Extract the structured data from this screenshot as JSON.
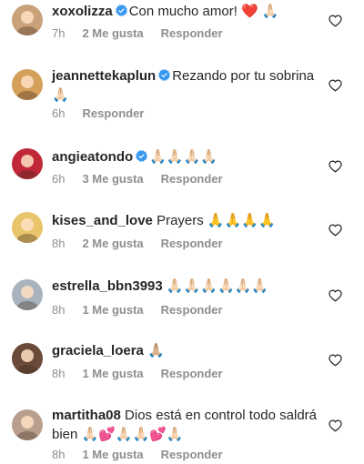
{
  "comments": [
    {
      "username": "xoxolizza",
      "verified": true,
      "text": "Con mucho amor! ❤️ 🙏🏻",
      "time": "7h",
      "likes": "2 Me gusta",
      "reply": "Responder",
      "avatar_color": "#c9a27a"
    },
    {
      "username": "jeannettekaplun",
      "verified": true,
      "text": "Rezando por tu sobrina 🙏🏻",
      "time": "6h",
      "likes": "",
      "reply": "Responder",
      "avatar_color": "#d4a05a"
    },
    {
      "username": "angieatondo",
      "verified": true,
      "text": "🙏🏻🙏🏻🙏🏻🙏🏻",
      "time": "6h",
      "likes": "3 Me gusta",
      "reply": "Responder",
      "avatar_color": "#c0283a"
    },
    {
      "username": "kises_and_love",
      "verified": false,
      "text": "Prayers 🙏🙏🙏🙏",
      "time": "8h",
      "likes": "2 Me gusta",
      "reply": "Responder",
      "avatar_color": "#e8c46a"
    },
    {
      "username": "estrella_bbn3993",
      "verified": false,
      "text": "🙏🏻🙏🏻🙏🏻🙏🏻🙏🏻🙏🏻",
      "time": "8h",
      "likes": "1 Me gusta",
      "reply": "Responder",
      "avatar_color": "#a9b3bd"
    },
    {
      "username": "graciela_loera",
      "verified": false,
      "text": "🙏🏼",
      "time": "8h",
      "likes": "1 Me gusta",
      "reply": "Responder",
      "avatar_color": "#6b4a3a"
    },
    {
      "username": "martitha08",
      "verified": false,
      "text": "Dios está en control todo saldrá bien 🙏🏻💕🙏🏻🙏🏻💕🙏🏻",
      "time": "8h",
      "likes": "1 Me gusta",
      "reply": "Responder",
      "avatar_color": "#b9a08e"
    }
  ],
  "icons": {
    "verified": "verified-badge-icon",
    "like": "heart-outline-icon"
  },
  "colors": {
    "text": "#262626",
    "meta": "#8e8e8e",
    "verified": "#3897f0"
  }
}
